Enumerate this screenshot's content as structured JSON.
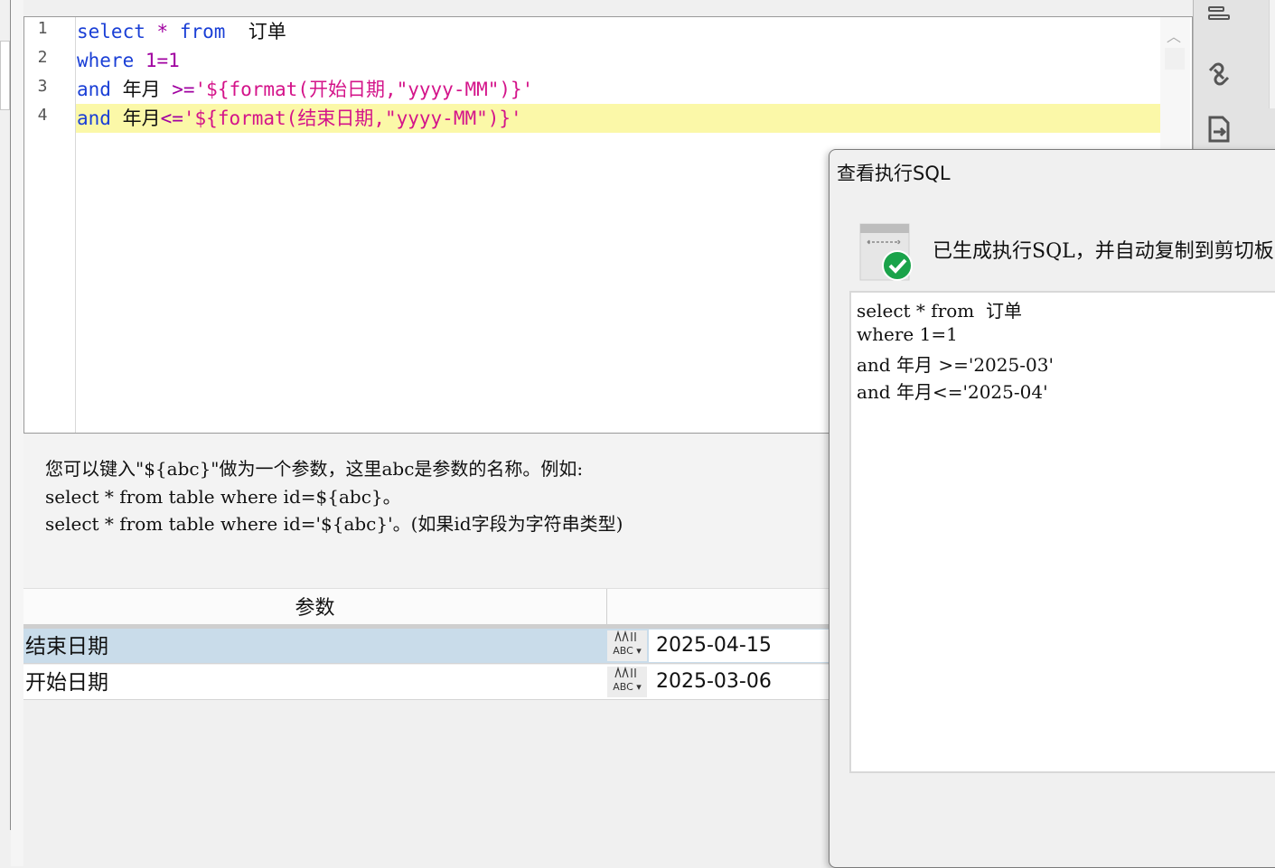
{
  "editor": {
    "line_numbers": [
      "1",
      "2",
      "3",
      "4"
    ],
    "lines": [
      [
        {
          "t": "kw",
          "v": "select"
        },
        {
          "t": "tx",
          "v": " "
        },
        {
          "t": "op",
          "v": "*"
        },
        {
          "t": "tx",
          "v": " "
        },
        {
          "t": "kw",
          "v": "from"
        },
        {
          "t": "tx",
          "v": "  订单"
        }
      ],
      [
        {
          "t": "kw",
          "v": "where"
        },
        {
          "t": "tx",
          "v": " "
        },
        {
          "t": "num",
          "v": "1=1"
        }
      ],
      [
        {
          "t": "kw",
          "v": "and"
        },
        {
          "t": "tx",
          "v": " 年月 "
        },
        {
          "t": "op",
          "v": ">="
        },
        {
          "t": "str",
          "v": "'${format(开始日期,\"yyyy-MM\")}'"
        }
      ],
      [
        {
          "t": "kw",
          "v": "and"
        },
        {
          "t": "tx",
          "v": " 年月"
        },
        {
          "t": "op",
          "v": "<="
        },
        {
          "t": "str",
          "v": "'${format(结束日期,\"yyyy-MM\")}'"
        }
      ]
    ],
    "highlight_color": "#fbf8a8",
    "keyword_color": "#1a3fd6",
    "string_color": "#d4148a"
  },
  "hint": {
    "line1": "您可以键入\"${abc}\"做为一个参数，这里abc是参数的名称。例如:",
    "line2": "select * from table where id=${abc}。",
    "line3": "select * from table where id='${abc}'。(如果id字段为字符串类型)"
  },
  "params": {
    "header": "参数",
    "rows": [
      {
        "name": "结束日期",
        "type_icon": "ABC",
        "value": "2025-04-15",
        "selected": true
      },
      {
        "name": "开始日期",
        "type_icon": "ABC",
        "value": "2025-03-06",
        "selected": false
      }
    ]
  },
  "dialog": {
    "title": "查看执行SQL",
    "message": "已生成执行SQL，并自动复制到剪切板",
    "sql_lines": [
      "select * from  订单",
      "where 1=1",
      "and 年月 >='2025-03'",
      "and 年月<='2025-04'"
    ]
  },
  "toolbar_icons": [
    "format-icon",
    "link-icon",
    "export-icon"
  ]
}
